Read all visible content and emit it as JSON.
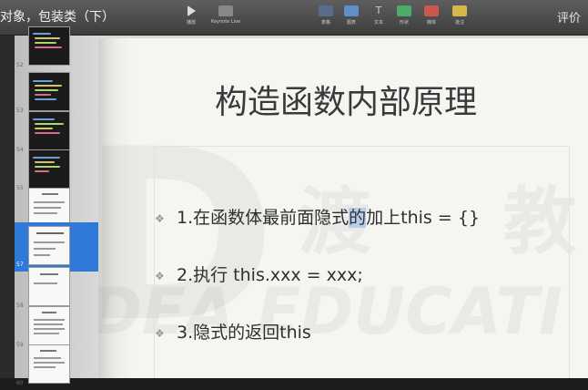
{
  "window": {
    "title": "对象，包装类（下）"
  },
  "toolbar": {
    "tools": [
      {
        "label": "播放"
      },
      {
        "label": "Keynote Live"
      },
      {
        "label": "表格"
      },
      {
        "label": "图表"
      },
      {
        "label": "文本"
      },
      {
        "label": "形状"
      },
      {
        "label": "媒体"
      },
      {
        "label": "批注"
      }
    ],
    "rate_label": "评价"
  },
  "sidebar": {
    "slides": [
      {
        "num": "52",
        "style": "dark"
      },
      {
        "num": "53",
        "style": "dark"
      },
      {
        "num": "54",
        "style": "dark"
      },
      {
        "num": "55",
        "style": "dark"
      },
      {
        "num": "56",
        "style": "light"
      },
      {
        "num": "57",
        "style": "light",
        "selected": true
      },
      {
        "num": "58",
        "style": "light"
      },
      {
        "num": "59",
        "style": "light"
      },
      {
        "num": "60",
        "style": "light"
      }
    ]
  },
  "slide": {
    "title": "构造函数内部原理",
    "bullets": [
      {
        "pre": "1.在函数体最前面隐式",
        "hl": "的",
        "post": "加上this = {}"
      },
      {
        "pre": "2.执行 this.xxx = xxx;",
        "hl": "",
        "post": ""
      },
      {
        "pre": "3.隐式的返回this",
        "hl": "",
        "post": ""
      }
    ],
    "watermark": {
      "cn1": "渡",
      "cn2": "教",
      "en": "DEA EDUCATI"
    }
  },
  "colors": {
    "selection": "#2f7ad9",
    "text_highlight": "#b9cdea"
  }
}
